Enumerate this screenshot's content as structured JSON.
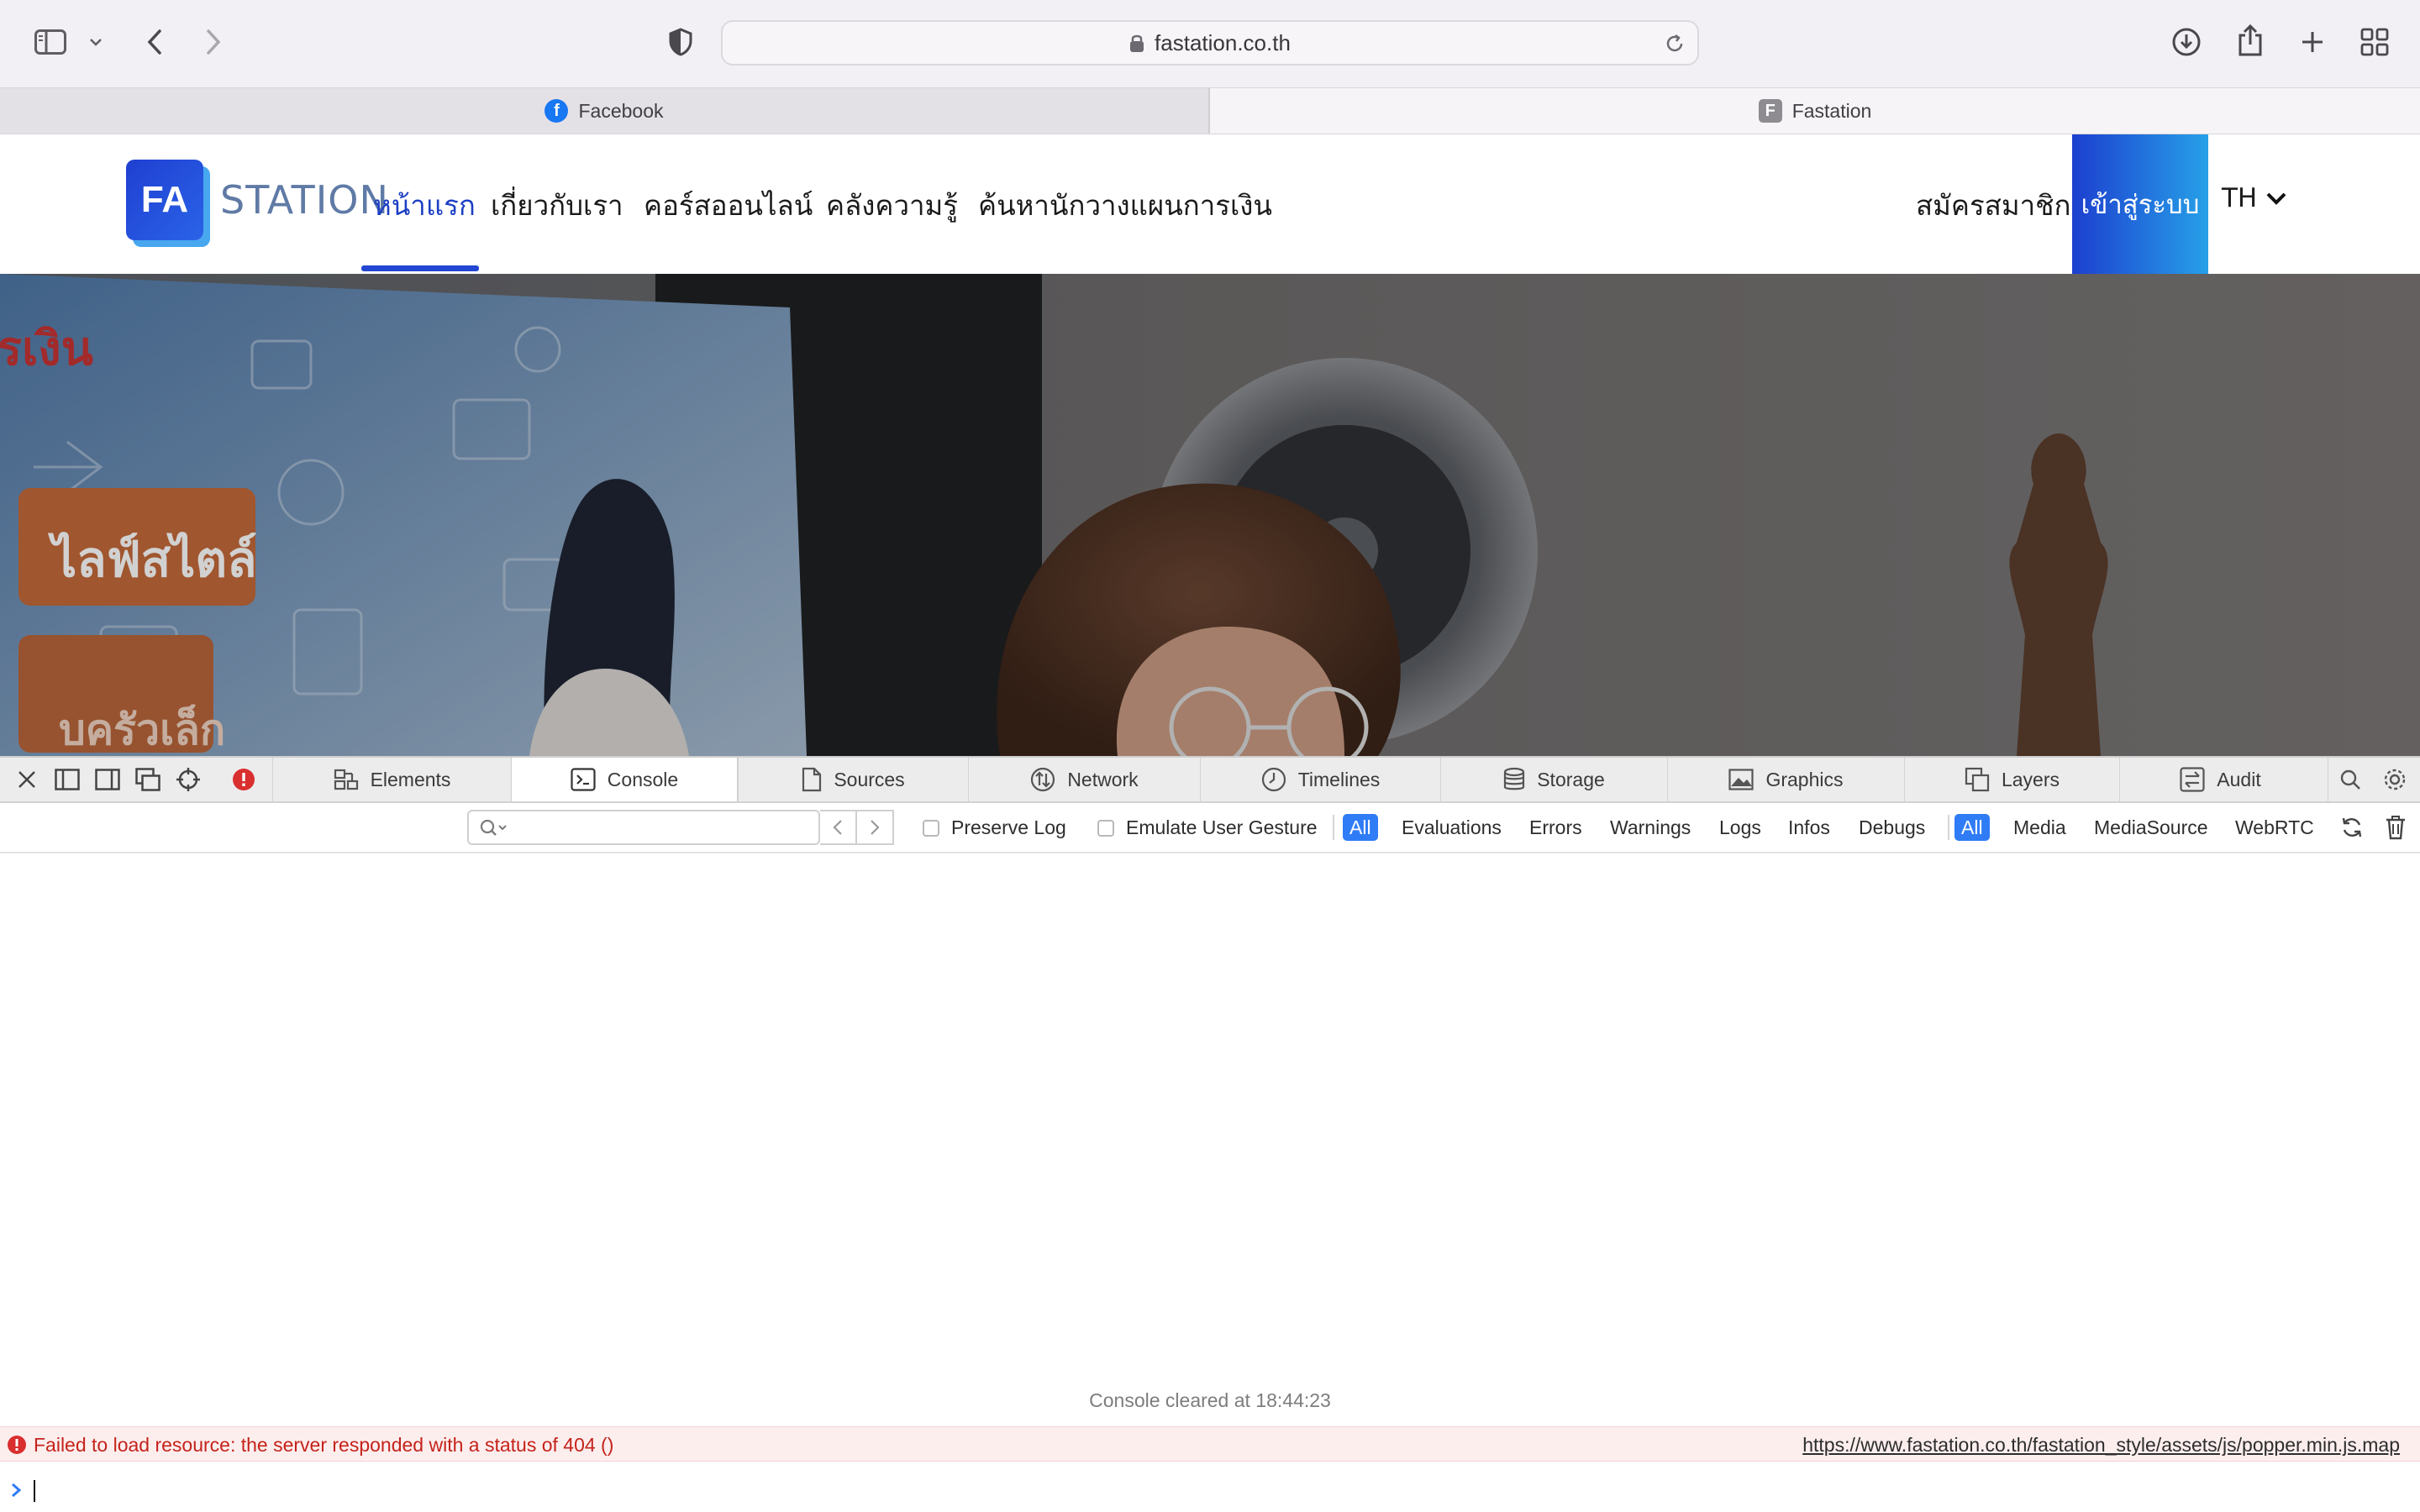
{
  "browser": {
    "url": "fastation.co.th",
    "tabs": [
      {
        "title": "Facebook",
        "icon": "facebook-icon",
        "active": false
      },
      {
        "title": "Fastation",
        "favicon_letter": "F",
        "active": true
      }
    ]
  },
  "site": {
    "logo_mark": "FA",
    "logo_word": "STATION",
    "nav": [
      "หน้าแรก",
      "เกี่ยวกับเรา",
      "คอร์สออนไลน์",
      "คลังความรู้",
      "ค้นหานักวางแผนการเงิน"
    ],
    "register": "สมัครสมาชิก",
    "login": "เข้าสู่ระบบ",
    "language": "TH",
    "hero_signs": [
      "รเงิน",
      "ไลฟ์สไตล์",
      "บครัวเล็ก"
    ]
  },
  "devtools": {
    "tabs": [
      "Elements",
      "Console",
      "Sources",
      "Network",
      "Timelines",
      "Storage",
      "Graphics",
      "Layers",
      "Audit"
    ],
    "active_tab": "Console",
    "filters": {
      "preserve_log": "Preserve Log",
      "emulate_gesture": "Emulate User Gesture",
      "levels": [
        "All",
        "Evaluations",
        "Errors",
        "Warnings",
        "Logs",
        "Infos",
        "Debugs"
      ],
      "sources": [
        "All",
        "Media",
        "MediaSource",
        "WebRTC"
      ]
    },
    "console": {
      "cleared": "Console cleared at 18:44:23",
      "error_message": "Failed to load resource: the server responded with a status of 404 ()",
      "error_source": "https://www.fastation.co.th/fastation_style/assets/js/popper.min.js.map"
    }
  },
  "colors": {
    "brand_blue": "#1d3fc4",
    "login_gradient_start": "#1c3fcf",
    "login_gradient_end": "#27a0e8",
    "error_red": "#c4231b",
    "filter_selected": "#2f7cf6"
  }
}
